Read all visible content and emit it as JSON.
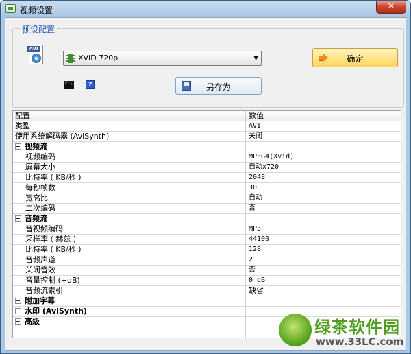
{
  "window": {
    "title": "视频设置",
    "close_label": "✕"
  },
  "preset_group": {
    "title": "预设配置",
    "avi_icon_tag": "AVI",
    "selected_preset": "XVID 720p",
    "ok_label": "确定",
    "saveas_label": "另存为",
    "cmd_icon_text": "C:\\",
    "help_icon_text": "?"
  },
  "grid": {
    "headers": [
      "配置",
      "数值"
    ],
    "rows": [
      {
        "label": "类型",
        "value": "AVI"
      },
      {
        "label": "使用系统解码器 (AviSynth)",
        "value": "关闭"
      },
      {
        "label": "视频流",
        "value": ""
      },
      {
        "label": "视频编码",
        "value": "MPEG4(Xvid)"
      },
      {
        "label": "屏幕大小",
        "value": "自动x720"
      },
      {
        "label": "比特率 ( KB/秒 )",
        "value": "2048"
      },
      {
        "label": "每秒帧数",
        "value": "30"
      },
      {
        "label": "宽高比",
        "value": "自动"
      },
      {
        "label": "二次编码",
        "value": "否"
      },
      {
        "label": "音频流",
        "value": ""
      },
      {
        "label": "音视频编码",
        "value": "MP3"
      },
      {
        "label": "采样率 ( 赫兹 )",
        "value": "44100"
      },
      {
        "label": "比特率 ( KB/秒 )",
        "value": "128"
      },
      {
        "label": "音频声道",
        "value": "2"
      },
      {
        "label": "关闭音效",
        "value": "否"
      },
      {
        "label": "音量控制 (+dB)",
        "value": "0 dB"
      },
      {
        "label": "音频流索引",
        "value": "缺省"
      },
      {
        "label": "附加字幕",
        "value": ""
      },
      {
        "label": "水印 (AviSynth)",
        "value": ""
      },
      {
        "label": "高级",
        "value": ""
      }
    ]
  },
  "watermark": {
    "brand": "绿茶软件园",
    "url": "www.33LC.com"
  }
}
